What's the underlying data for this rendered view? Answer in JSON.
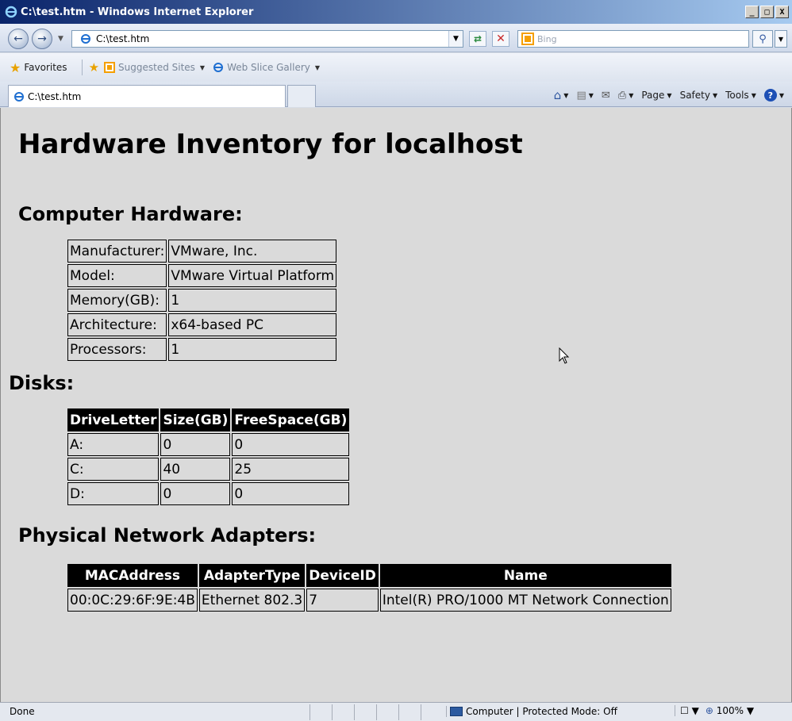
{
  "window": {
    "title": "C:\\test.htm - Windows Internet Explorer",
    "btn_min": "_",
    "btn_max": "□",
    "btn_close": "X"
  },
  "address_bar": {
    "url": "C:\\test.htm"
  },
  "search": {
    "placeholder": "Bing"
  },
  "favorites_bar": {
    "favorites_label": "Favorites",
    "suggested_sites": "Suggested Sites",
    "web_slice_gallery": "Web Slice Gallery"
  },
  "tab": {
    "title": "C:\\test.htm"
  },
  "command_bar": {
    "page": "Page",
    "safety": "Safety",
    "tools": "Tools"
  },
  "content": {
    "title": "Hardware Inventory for localhost",
    "computer_heading": "Computer Hardware:",
    "computer_rows": [
      {
        "label": "Manufacturer:",
        "value": "VMware, Inc."
      },
      {
        "label": "Model:",
        "value": "VMware Virtual Platform"
      },
      {
        "label": "Memory(GB):",
        "value": "1"
      },
      {
        "label": "Architecture:",
        "value": "x64-based PC"
      },
      {
        "label": "Processors:",
        "value": "1"
      }
    ],
    "disks_heading": "Disks:",
    "disk_headers": [
      "DriveLetter",
      "Size(GB)",
      "FreeSpace(GB)"
    ],
    "disk_rows": [
      [
        "A:",
        "0",
        "0"
      ],
      [
        "C:",
        "40",
        "25"
      ],
      [
        "D:",
        "0",
        "0"
      ]
    ],
    "network_heading": "Physical Network Adapters:",
    "network_headers": [
      "MACAddress",
      "AdapterType",
      "DeviceID",
      "Name"
    ],
    "network_rows": [
      [
        "00:0C:29:6F:9E:4B",
        "Ethernet 802.3",
        "7",
        "Intel(R) PRO/1000 MT Network Connection"
      ]
    ]
  },
  "status_bar": {
    "status": "Done",
    "zone": "Computer | Protected Mode: Off",
    "zoom": "100%"
  },
  "colors": {
    "content_bg": "#dadada",
    "header_bg": "#000000",
    "header_text": "#ffffff"
  }
}
